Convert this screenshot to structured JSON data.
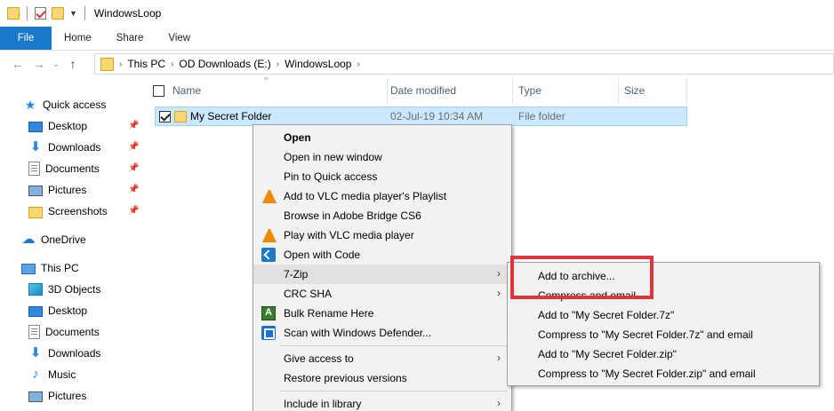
{
  "window": {
    "title": "WindowsLoop"
  },
  "ribbon": {
    "tabs": [
      "File",
      "Home",
      "Share",
      "View"
    ]
  },
  "address": {
    "crumbs": [
      "This PC",
      "OD Downloads (E:)",
      "WindowsLoop"
    ]
  },
  "sidebar": {
    "quick_access": "Quick access",
    "quick_items": [
      "Desktop",
      "Downloads",
      "Documents",
      "Pictures",
      "Screenshots"
    ],
    "onedrive": "OneDrive",
    "this_pc": "This PC",
    "pc_items": [
      "3D Objects",
      "Desktop",
      "Documents",
      "Downloads",
      "Music",
      "Pictures"
    ]
  },
  "columns": {
    "name": "Name",
    "date": "Date modified",
    "type": "Type",
    "size": "Size"
  },
  "file": {
    "name": "My Secret Folder",
    "date": "02-Jul-19 10:34 AM",
    "type": "File folder"
  },
  "context_menu": {
    "items": [
      "Open",
      "Open in new window",
      "Pin to Quick access",
      "Add to VLC media player's Playlist",
      "Browse in Adobe Bridge CS6",
      "Play with VLC media player",
      "Open with Code",
      "7-Zip",
      "CRC SHA",
      "Bulk Rename Here",
      "Scan with Windows Defender...",
      "Give access to",
      "Restore previous versions",
      "Include in library"
    ]
  },
  "submenu": {
    "items": [
      "Add to archive...",
      "Compress and email...",
      "Add to \"My Secret Folder.7z\"",
      "Compress to \"My Secret Folder.7z\" and email",
      "Add to \"My Secret Folder.zip\"",
      "Compress to \"My Secret Folder.zip\" and email"
    ]
  },
  "colors": {
    "accent": "#1979ca",
    "selection": "#cce8ff",
    "highlight_box": "#e3333a"
  }
}
